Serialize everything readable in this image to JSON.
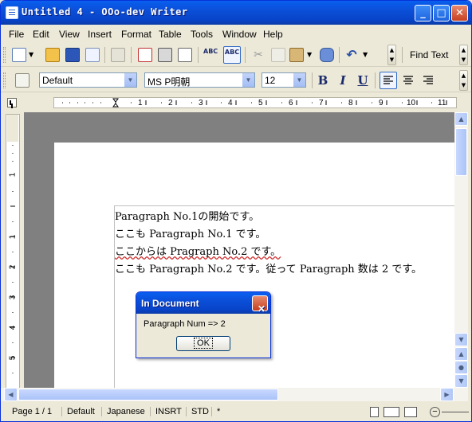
{
  "window": {
    "title": "Untitled 4 - OOo-dev Writer",
    "controls": {
      "minimize": "_",
      "maximize": "□",
      "close": "✕"
    }
  },
  "menu": [
    "File",
    "Edit",
    "View",
    "Insert",
    "Format",
    "Table",
    "Tools",
    "Window",
    "Help"
  ],
  "toolbar": {
    "find_text": "Find Text",
    "icons": [
      "new-document-icon",
      "open-folder-icon",
      "save-icon",
      "email-icon",
      "edit-file-icon",
      "export-pdf-icon",
      "print-icon",
      "page-preview-icon",
      "spellcheck-icon",
      "autospellcheck-icon",
      "cut-icon",
      "copy-icon",
      "paste-icon",
      "format-paintbrush-icon",
      "undo-icon"
    ]
  },
  "format_bar": {
    "style": "Default",
    "font": "MS P明朝",
    "size": "12",
    "bold": "B",
    "italic": "I",
    "underline": "U"
  },
  "ruler": {
    "h_numbers": [
      "1",
      "2",
      "3",
      "4",
      "5",
      "6",
      "7",
      "8",
      "9",
      "10",
      "11"
    ],
    "v_numbers": [
      "1",
      "1",
      "2",
      "3",
      "4",
      "5"
    ]
  },
  "document": {
    "lines": [
      "Paragraph No.1の開始です。",
      "ここも Paragraph No.1 です。",
      "ここからは Pragraph No.2 です。",
      "ここも Paragraph No.2 です。従って Paragraph 数は 2 です。"
    ]
  },
  "dialog": {
    "title": "In Document",
    "message": "Paragraph Num => 2",
    "ok": "OK",
    "close": "✕"
  },
  "status": {
    "page": "Page 1 / 1",
    "style": "Default",
    "language": "Japanese",
    "insert_mode": "INSRT",
    "selection_mode": "STD",
    "modified": "*"
  }
}
